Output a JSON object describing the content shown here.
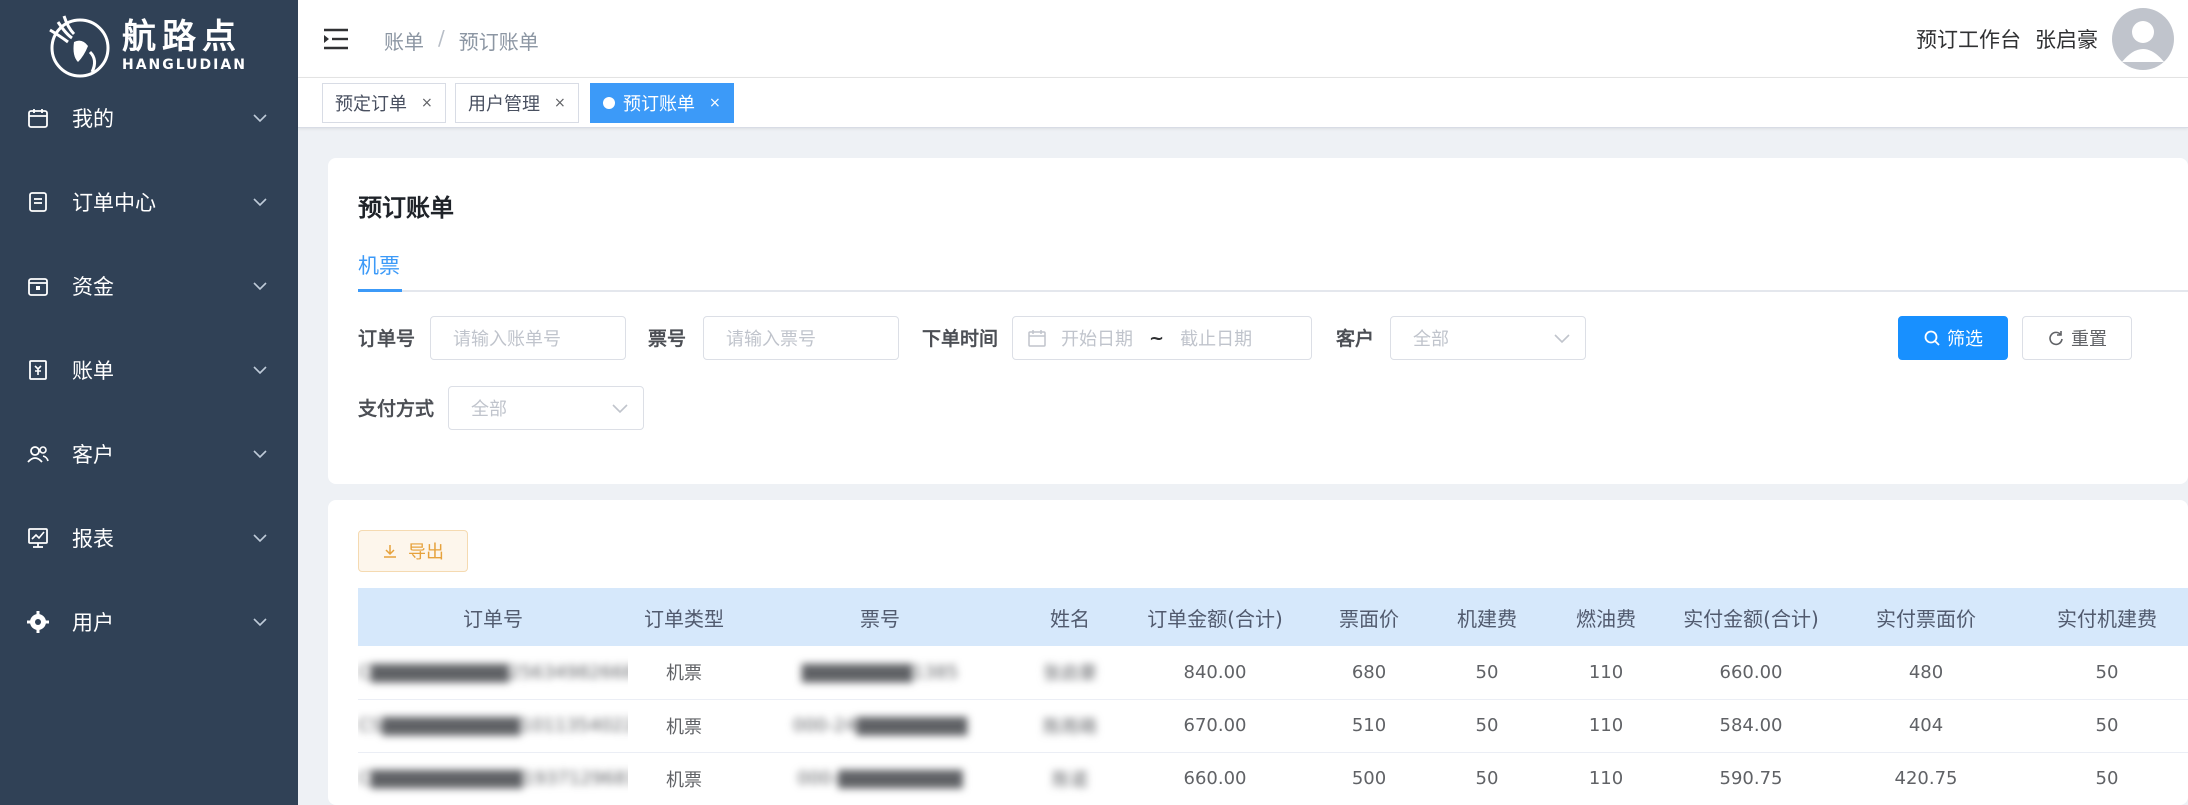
{
  "sidebar": {
    "logo_cn": "航路点",
    "logo_en": "HANGLUDIAN",
    "items": [
      {
        "label": "我的",
        "icon": "calendar-icon"
      },
      {
        "label": "订单中心",
        "icon": "list-icon"
      },
      {
        "label": "资金",
        "icon": "wallet-icon"
      },
      {
        "label": "账单",
        "icon": "bill-icon"
      },
      {
        "label": "客户",
        "icon": "users-icon"
      },
      {
        "label": "报表",
        "icon": "chart-icon"
      },
      {
        "label": "用户",
        "icon": "gear-icon"
      }
    ]
  },
  "header": {
    "breadcrumb": [
      "账单",
      "预订账单"
    ],
    "breadcrumb_sep": "/",
    "workbench": "预订工作台",
    "username": "张启豪"
  },
  "tags": [
    {
      "label": "预定订单",
      "active": false
    },
    {
      "label": "用户管理",
      "active": false
    },
    {
      "label": "预订账单",
      "active": true
    }
  ],
  "tag_close": "×",
  "filter": {
    "title": "预订账单",
    "subtab": "机票",
    "order_no_label": "订单号",
    "order_no_placeholder": "请输入账单号",
    "ticket_no_label": "票号",
    "ticket_no_placeholder": "请输入票号",
    "time_label": "下单时间",
    "start_placeholder": "开始日期",
    "range_sep": "~",
    "end_placeholder": "截止日期",
    "customer_label": "客户",
    "customer_value": "全部",
    "pay_label": "支付方式",
    "pay_value": "全部",
    "search_btn": "筛选",
    "reset_btn": "重置"
  },
  "table": {
    "export_btn": "导出",
    "columns": [
      "订单号",
      "订单类型",
      "票号",
      "姓名",
      "订单金额(合计)",
      "票面价",
      "机建费",
      "燃油费",
      "实付金额(合计)",
      "实付票面价",
      "实付机建费"
    ],
    "rows": [
      {
        "order_no": "C▇▇▇▇▇▇▇▇▇▇25634982668",
        "type": "机票",
        "ticket": "▇▇▇▇▇▇▇▇1385",
        "name": "张启豪",
        "amount": "840.00",
        "face": "680",
        "airport": "50",
        "fuel": "110",
        "paid": "660.00",
        "paid_face": "480",
        "paid_airport": "50"
      },
      {
        "order_no": "CS▇▇▇▇▇▇▇▇▇▇10113540226",
        "type": "机票",
        "ticket": "000-24▇▇▇▇▇▇▇▇",
        "name": "陈雨萌",
        "amount": "670.00",
        "face": "510",
        "airport": "50",
        "fuel": "110",
        "paid": "584.00",
        "paid_face": "404",
        "paid_airport": "50"
      },
      {
        "order_no": "C▇▇▇▇▇▇▇▇▇▇▇1937129681",
        "type": "机票",
        "ticket": "000-▇▇▇▇▇▇▇▇▇",
        "name": "陈诺",
        "amount": "660.00",
        "face": "500",
        "airport": "50",
        "fuel": "110",
        "paid": "590.75",
        "paid_face": "420.75",
        "paid_airport": "50"
      }
    ]
  }
}
